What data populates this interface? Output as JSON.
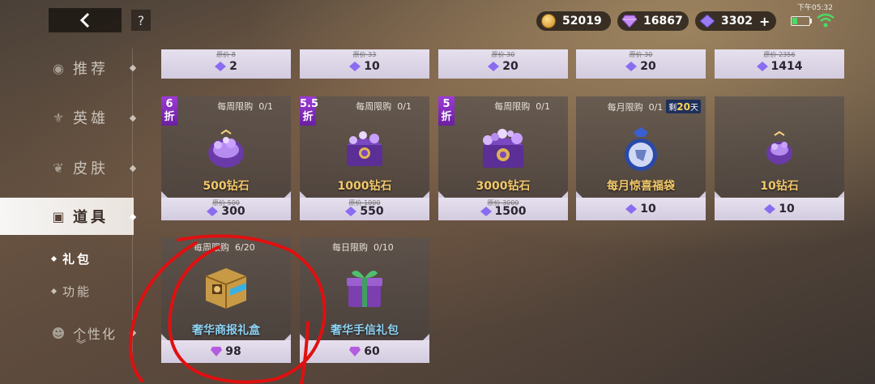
{
  "status": {
    "time": "下午05:32"
  },
  "header": {
    "help_label": "?",
    "currencies": [
      {
        "name": "gold",
        "value": "52019",
        "color": "#e0a830"
      },
      {
        "name": "diamond",
        "value": "16867",
        "color": "#c48bf0"
      },
      {
        "name": "crystal",
        "value": "3302",
        "color": "#9a7cf5",
        "action": "+"
      }
    ]
  },
  "sidebar": {
    "items": [
      {
        "label": "推荐",
        "icon": "recommend-icon"
      },
      {
        "label": "英雄",
        "icon": "hero-icon"
      },
      {
        "label": "皮肤",
        "icon": "skin-icon"
      },
      {
        "label": "道具",
        "icon": "item-icon",
        "active": true
      },
      {
        "label": "个性化",
        "icon": "personalize-icon"
      }
    ],
    "subitems": [
      {
        "label": "礼包",
        "active": true
      },
      {
        "label": "功能"
      }
    ]
  },
  "top_row": [
    {
      "orig_label": "原价",
      "orig_value": "8",
      "price": "2"
    },
    {
      "orig_label": "原价",
      "orig_value": "33",
      "price": "10"
    },
    {
      "orig_label": "原价",
      "orig_value": "30",
      "price": "20"
    },
    {
      "orig_label": "原价",
      "orig_value": "30",
      "price": "20"
    },
    {
      "orig_label": "原价",
      "orig_value": "2356",
      "price": "1414"
    }
  ],
  "cards": [
    {
      "name": "500钻石",
      "limit": "每周限购",
      "count": "0/1",
      "discount": "6",
      "discount_unit": "折",
      "orig_label": "原价",
      "orig_value": "500",
      "price": "300",
      "icon": "diamond-bag-icon"
    },
    {
      "name": "1000钻石",
      "limit": "每周限购",
      "count": "0/1",
      "discount": "5.5",
      "discount_unit": "折",
      "orig_label": "原价",
      "orig_value": "1000",
      "price": "550",
      "icon": "diamond-chest-icon"
    },
    {
      "name": "3000钻石",
      "limit": "每周限购",
      "count": "0/1",
      "discount": "5",
      "discount_unit": "折",
      "orig_label": "原价",
      "orig_value": "3000",
      "price": "1500",
      "icon": "diamond-chest-large-icon"
    },
    {
      "name": "每月惊喜福袋",
      "limit": "每月限购",
      "count": "0/1",
      "remain_prefix": "剩",
      "remain_num": "20",
      "remain_suffix": "天",
      "price": "10",
      "icon": "lucky-bag-icon"
    },
    {
      "name": "10钻石",
      "price": "10",
      "icon": "small-diamond-bag-icon"
    },
    {
      "name": "奢华商报礼盒",
      "limit": "每周限购",
      "count": "6/20",
      "price": "98",
      "icon": "luxury-box-icon"
    },
    {
      "name": "奢华手信礼包",
      "limit": "每日限购",
      "count": "0/10",
      "price": "60",
      "icon": "luxury-gift-icon"
    }
  ]
}
